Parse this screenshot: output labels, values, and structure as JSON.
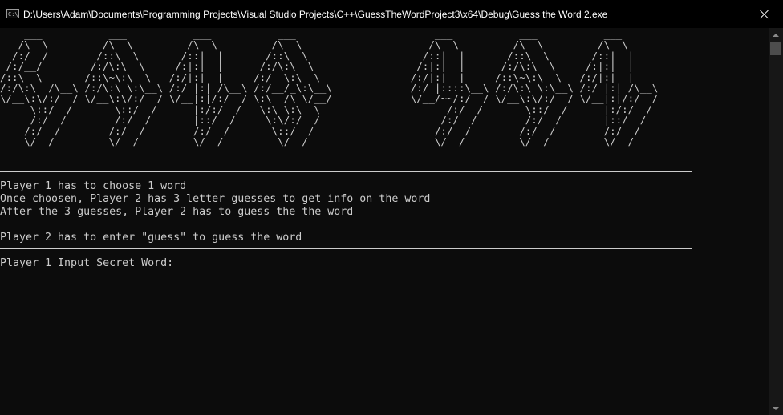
{
  "window": {
    "title": "D:\\Users\\Adam\\Documents\\Programming Projects\\Visual Studio Projects\\C++\\GuessTheWordProject3\\x64\\Debug\\Guess the Word 2.exe",
    "icon_text": "C:\\",
    "icon": "console-app-icon",
    "controls": [
      "minimize-icon",
      "maximize-icon",
      "close-icon"
    ]
  },
  "console": {
    "banner_art": "    ___           ___           ___           ___                       ___           ___           ___     \n   /\\__\\         /\\  \\         /\\__\\         /\\  \\                     /\\__\\         /\\  \\         /\\__\\    \n  /:/  /        /::\\  \\       /::|  |       /::\\  \\                   /::|  |       /::\\  \\       /::|  |   \n /:/__/        /:/\\:\\  \\     /:|:|  |      /:/\\:\\  \\                 /:|:|  |      /:/\\:\\  \\     /:|:|  |   \n/::\\  \\ ___   /::\\~\\:\\  \\   /:/|:|  |__   /:/  \\:\\  \\               /:/|:|__|__   /::\\~\\:\\  \\   /:/|:|  |__ \n/:/\\:\\  /\\__\\ /:/\\:\\ \\:\\__\\ /:/ |:| /\\__\\ /:/__/_\\:\\__\\             /:/ |::::\\__\\ /:/\\:\\ \\:\\__\\ /:/ |:| /\\__\\\n\\/__\\:\\/:/  / \\/__\\:\\/:/  / \\/__|:|/:/  / \\:\\  /\\ \\/__/             \\/__/~~/:/  / \\/__\\:\\/:/  / \\/__|:|/:/  /\n     \\::/  /       \\::/  /      |:/:/  /   \\:\\ \\:\\__\\                     /:/  /       \\::/  /      |:/:/  / \n     /:/  /        /:/  /       |::/  /     \\:\\/:/  /                    /:/  /        /:/  /       |::/  /  \n    /:/  /        /:/  /        /:/  /       \\::/  /                    /:/  /        /:/  /        /:/  /   \n    \\/__/         \\/__/         \\/__/         \\/__/                     \\/__/         \\/__/         \\/__/    ",
    "instructions": [
      "Player 1 has to choose 1 word",
      "Once choosen, Player 2 has 3 letter guesses to get info on the word",
      "After the 3 guesses, Player 2 has to guess the the word",
      "Player 2 has to enter \"guess\" to guess the word"
    ],
    "prompt": "Player 1 Input Secret Word:"
  },
  "colors": {
    "background": "#0c0c0c",
    "foreground": "#cccccc",
    "titlebar": "#000000",
    "scrollbar_track": "#171717",
    "scrollbar_thumb": "#4d4d4d"
  }
}
